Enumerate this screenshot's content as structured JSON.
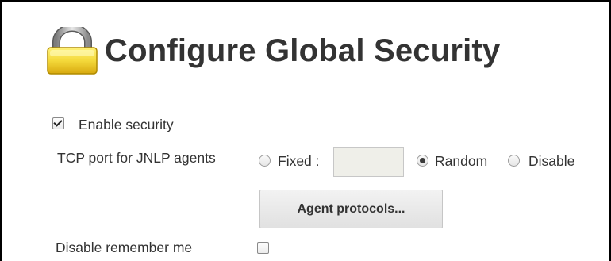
{
  "page": {
    "title": "Configure Global Security",
    "title_icon": "padlock-icon"
  },
  "security": {
    "enable_label": "Enable security",
    "enable_checked": true
  },
  "jnlp": {
    "label": "TCP port for JNLP agents",
    "options": [
      {
        "label": "Fixed :",
        "selected": false
      },
      {
        "label": "Random",
        "selected": true
      },
      {
        "label": "Disable",
        "selected": false
      }
    ],
    "fixed_value": ""
  },
  "agent_protocols_button": "Agent protocols...",
  "remember_me": {
    "label": "Disable remember me",
    "checked": false
  },
  "colors": {
    "text": "#333333",
    "input_bg": "#efefe9",
    "lock_yellow": "#f2d23a"
  }
}
